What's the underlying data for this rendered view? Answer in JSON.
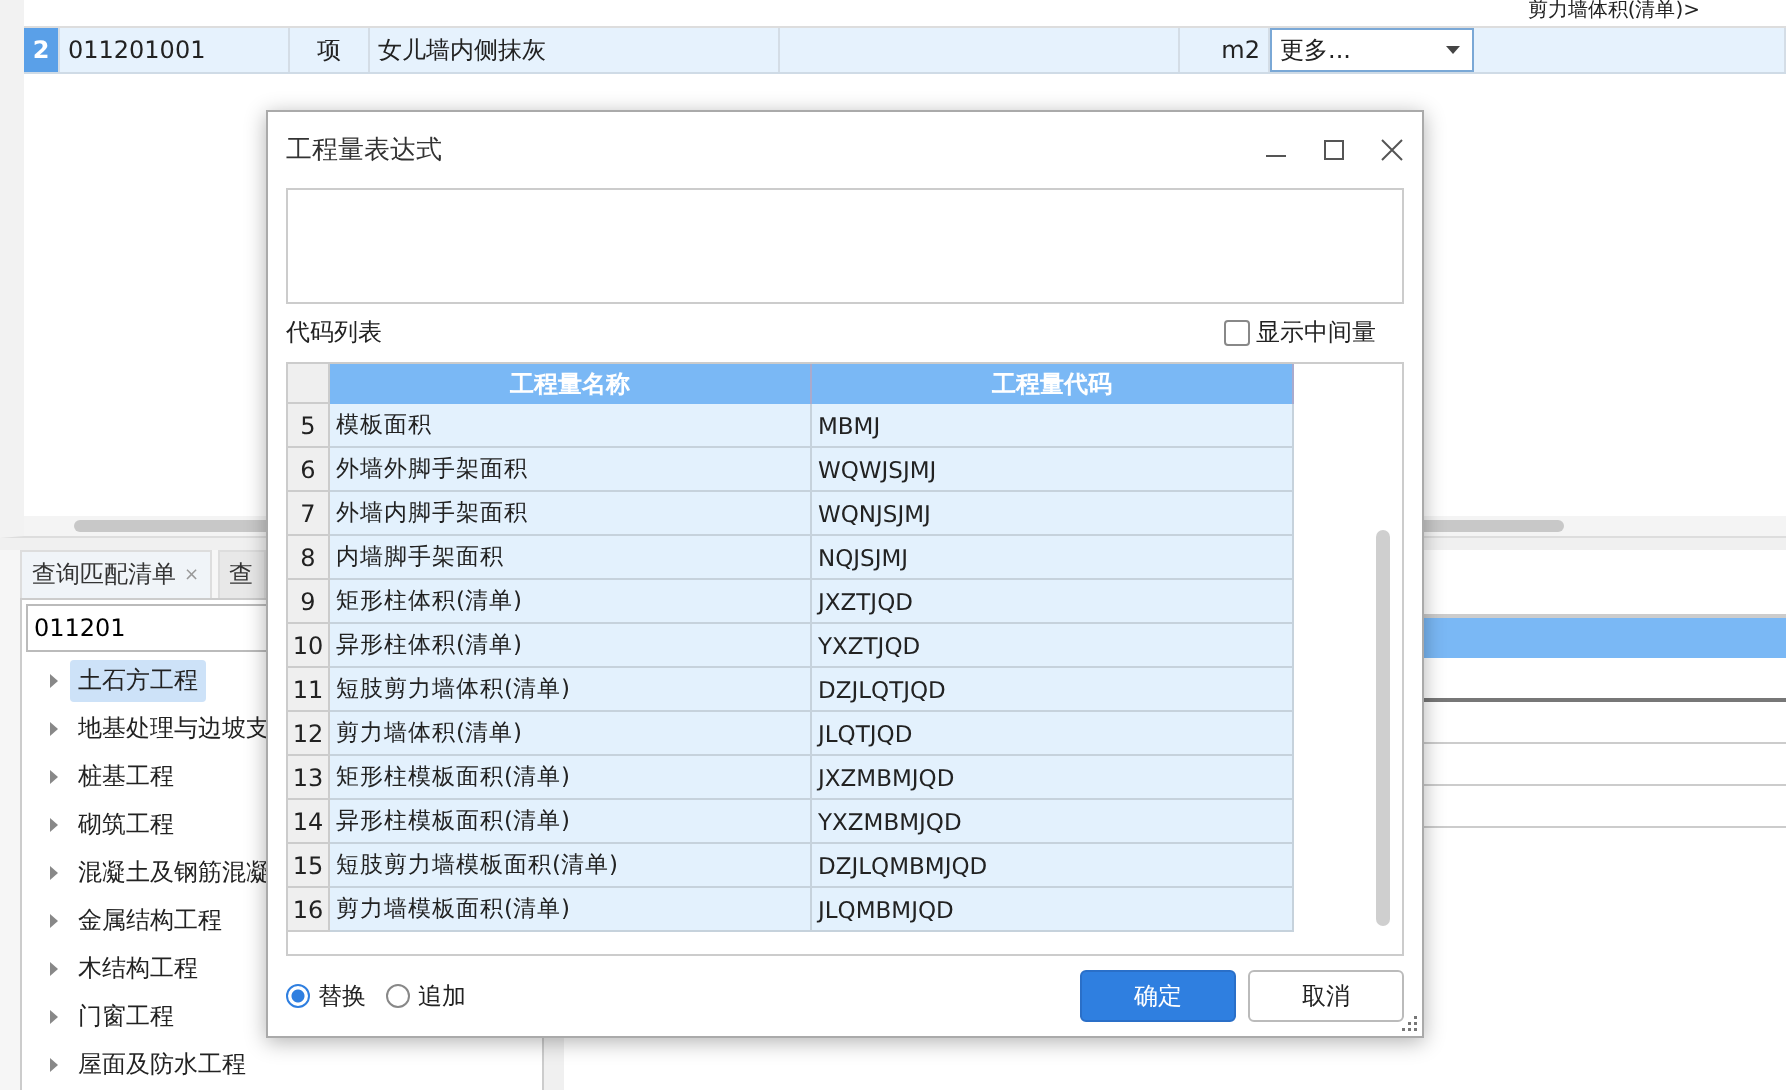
{
  "top_table": {
    "header_fragment": "剪力墙体积(清单)>",
    "row": {
      "number": "2",
      "code": "011201001",
      "unit_type": "项",
      "name": "女儿墙内侧抹灰",
      "unit": "m2",
      "dropdown": "更多..."
    }
  },
  "bottom_panel": {
    "tabs": [
      {
        "label": "查询匹配清单",
        "close": "×",
        "selected": true
      },
      {
        "label": "查",
        "selected": false
      }
    ],
    "search": {
      "value": "011201"
    },
    "tree": [
      {
        "label": "土石方工程",
        "selected": true
      },
      {
        "label": "地基处理与边坡支",
        "selected": false
      },
      {
        "label": "桩基工程",
        "selected": false
      },
      {
        "label": "砌筑工程",
        "selected": false
      },
      {
        "label": "混凝土及钢筋混凝",
        "selected": false
      },
      {
        "label": "金属结构工程",
        "selected": false
      },
      {
        "label": "木结构工程",
        "selected": false
      },
      {
        "label": "门窗工程",
        "selected": false
      },
      {
        "label": "屋面及防水工程",
        "selected": false
      }
    ]
  },
  "dialog": {
    "title": "工程量表达式",
    "code_list_label": "代码列表",
    "show_intermediate": {
      "label": "显示中间量",
      "checked": false
    },
    "columns": [
      "工程量名称",
      "工程量代码"
    ],
    "rows": [
      [
        "5",
        "模板面积",
        "MBMJ"
      ],
      [
        "6",
        "外墙外脚手架面积",
        "WQWJSJMJ"
      ],
      [
        "7",
        "外墙内脚手架面积",
        "WQNJSJMJ"
      ],
      [
        "8",
        "内墙脚手架面积",
        "NQJSJMJ"
      ],
      [
        "9",
        "矩形柱体积(清单)",
        "JXZTJQD"
      ],
      [
        "10",
        "异形柱体积(清单)",
        "YXZTJQD"
      ],
      [
        "11",
        "短肢剪力墙体积(清单)",
        "DZJLQTJQD"
      ],
      [
        "12",
        "剪力墙体积(清单)",
        "JLQTJQD"
      ],
      [
        "13",
        "矩形柱模板面积(清单)",
        "JXZMBMJQD"
      ],
      [
        "14",
        "异形柱模板面积(清单)",
        "YXZMBMJQD"
      ],
      [
        "15",
        "短肢剪力墙模板面积(清单)",
        "DZJLQMBMJQD"
      ],
      [
        "16",
        "剪力墙模板面积(清单)",
        "JLQMBMJQD"
      ]
    ],
    "modes": [
      {
        "label": "替换",
        "selected": true
      },
      {
        "label": "追加",
        "selected": false
      }
    ],
    "buttons": [
      {
        "label": "确定",
        "kind": "primary"
      },
      {
        "label": "取消",
        "kind": "secondary"
      }
    ]
  }
}
